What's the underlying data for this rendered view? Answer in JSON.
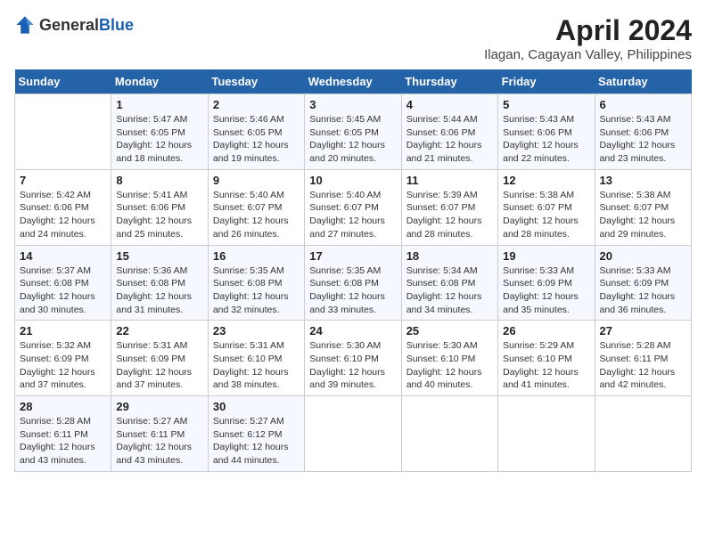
{
  "header": {
    "logo_general": "General",
    "logo_blue": "Blue",
    "month_title": "April 2024",
    "location": "Ilagan, Cagayan Valley, Philippines"
  },
  "weekdays": [
    "Sunday",
    "Monday",
    "Tuesday",
    "Wednesday",
    "Thursday",
    "Friday",
    "Saturday"
  ],
  "weeks": [
    [
      {
        "day": "",
        "info": ""
      },
      {
        "day": "1",
        "info": "Sunrise: 5:47 AM\nSunset: 6:05 PM\nDaylight: 12 hours\nand 18 minutes."
      },
      {
        "day": "2",
        "info": "Sunrise: 5:46 AM\nSunset: 6:05 PM\nDaylight: 12 hours\nand 19 minutes."
      },
      {
        "day": "3",
        "info": "Sunrise: 5:45 AM\nSunset: 6:05 PM\nDaylight: 12 hours\nand 20 minutes."
      },
      {
        "day": "4",
        "info": "Sunrise: 5:44 AM\nSunset: 6:06 PM\nDaylight: 12 hours\nand 21 minutes."
      },
      {
        "day": "5",
        "info": "Sunrise: 5:43 AM\nSunset: 6:06 PM\nDaylight: 12 hours\nand 22 minutes."
      },
      {
        "day": "6",
        "info": "Sunrise: 5:43 AM\nSunset: 6:06 PM\nDaylight: 12 hours\nand 23 minutes."
      }
    ],
    [
      {
        "day": "7",
        "info": "Sunrise: 5:42 AM\nSunset: 6:06 PM\nDaylight: 12 hours\nand 24 minutes."
      },
      {
        "day": "8",
        "info": "Sunrise: 5:41 AM\nSunset: 6:06 PM\nDaylight: 12 hours\nand 25 minutes."
      },
      {
        "day": "9",
        "info": "Sunrise: 5:40 AM\nSunset: 6:07 PM\nDaylight: 12 hours\nand 26 minutes."
      },
      {
        "day": "10",
        "info": "Sunrise: 5:40 AM\nSunset: 6:07 PM\nDaylight: 12 hours\nand 27 minutes."
      },
      {
        "day": "11",
        "info": "Sunrise: 5:39 AM\nSunset: 6:07 PM\nDaylight: 12 hours\nand 28 minutes."
      },
      {
        "day": "12",
        "info": "Sunrise: 5:38 AM\nSunset: 6:07 PM\nDaylight: 12 hours\nand 28 minutes."
      },
      {
        "day": "13",
        "info": "Sunrise: 5:38 AM\nSunset: 6:07 PM\nDaylight: 12 hours\nand 29 minutes."
      }
    ],
    [
      {
        "day": "14",
        "info": "Sunrise: 5:37 AM\nSunset: 6:08 PM\nDaylight: 12 hours\nand 30 minutes."
      },
      {
        "day": "15",
        "info": "Sunrise: 5:36 AM\nSunset: 6:08 PM\nDaylight: 12 hours\nand 31 minutes."
      },
      {
        "day": "16",
        "info": "Sunrise: 5:35 AM\nSunset: 6:08 PM\nDaylight: 12 hours\nand 32 minutes."
      },
      {
        "day": "17",
        "info": "Sunrise: 5:35 AM\nSunset: 6:08 PM\nDaylight: 12 hours\nand 33 minutes."
      },
      {
        "day": "18",
        "info": "Sunrise: 5:34 AM\nSunset: 6:08 PM\nDaylight: 12 hours\nand 34 minutes."
      },
      {
        "day": "19",
        "info": "Sunrise: 5:33 AM\nSunset: 6:09 PM\nDaylight: 12 hours\nand 35 minutes."
      },
      {
        "day": "20",
        "info": "Sunrise: 5:33 AM\nSunset: 6:09 PM\nDaylight: 12 hours\nand 36 minutes."
      }
    ],
    [
      {
        "day": "21",
        "info": "Sunrise: 5:32 AM\nSunset: 6:09 PM\nDaylight: 12 hours\nand 37 minutes."
      },
      {
        "day": "22",
        "info": "Sunrise: 5:31 AM\nSunset: 6:09 PM\nDaylight: 12 hours\nand 37 minutes."
      },
      {
        "day": "23",
        "info": "Sunrise: 5:31 AM\nSunset: 6:10 PM\nDaylight: 12 hours\nand 38 minutes."
      },
      {
        "day": "24",
        "info": "Sunrise: 5:30 AM\nSunset: 6:10 PM\nDaylight: 12 hours\nand 39 minutes."
      },
      {
        "day": "25",
        "info": "Sunrise: 5:30 AM\nSunset: 6:10 PM\nDaylight: 12 hours\nand 40 minutes."
      },
      {
        "day": "26",
        "info": "Sunrise: 5:29 AM\nSunset: 6:10 PM\nDaylight: 12 hours\nand 41 minutes."
      },
      {
        "day": "27",
        "info": "Sunrise: 5:28 AM\nSunset: 6:11 PM\nDaylight: 12 hours\nand 42 minutes."
      }
    ],
    [
      {
        "day": "28",
        "info": "Sunrise: 5:28 AM\nSunset: 6:11 PM\nDaylight: 12 hours\nand 43 minutes."
      },
      {
        "day": "29",
        "info": "Sunrise: 5:27 AM\nSunset: 6:11 PM\nDaylight: 12 hours\nand 43 minutes."
      },
      {
        "day": "30",
        "info": "Sunrise: 5:27 AM\nSunset: 6:12 PM\nDaylight: 12 hours\nand 44 minutes."
      },
      {
        "day": "",
        "info": ""
      },
      {
        "day": "",
        "info": ""
      },
      {
        "day": "",
        "info": ""
      },
      {
        "day": "",
        "info": ""
      }
    ]
  ]
}
